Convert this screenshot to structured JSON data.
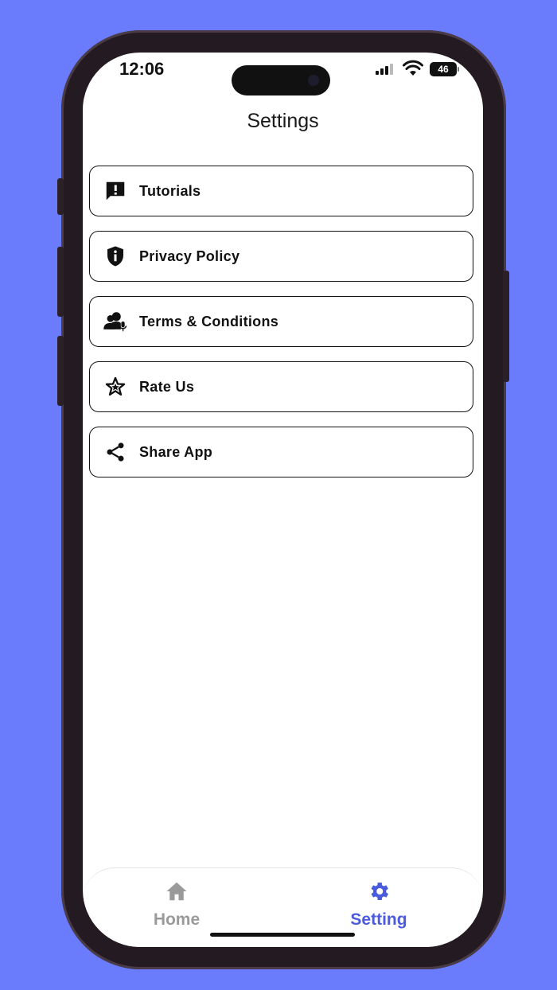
{
  "status": {
    "time": "12:06",
    "battery": "46"
  },
  "page": {
    "title": "Settings"
  },
  "menu": {
    "items": [
      {
        "label": "Tutorials",
        "icon": "alert-message-icon"
      },
      {
        "label": "Privacy Policy",
        "icon": "shield-info-icon"
      },
      {
        "label": "Terms & Conditions",
        "icon": "users-mic-icon"
      },
      {
        "label": "Rate Us",
        "icon": "star-icon"
      },
      {
        "label": "Share App",
        "icon": "share-icon"
      }
    ]
  },
  "tabbar": {
    "home_label": "Home",
    "setting_label": "Setting",
    "active": "setting",
    "active_color": "#4a5bdc",
    "inactive_color": "#9a9a9a"
  },
  "colors": {
    "background": "#6a7cfc"
  }
}
